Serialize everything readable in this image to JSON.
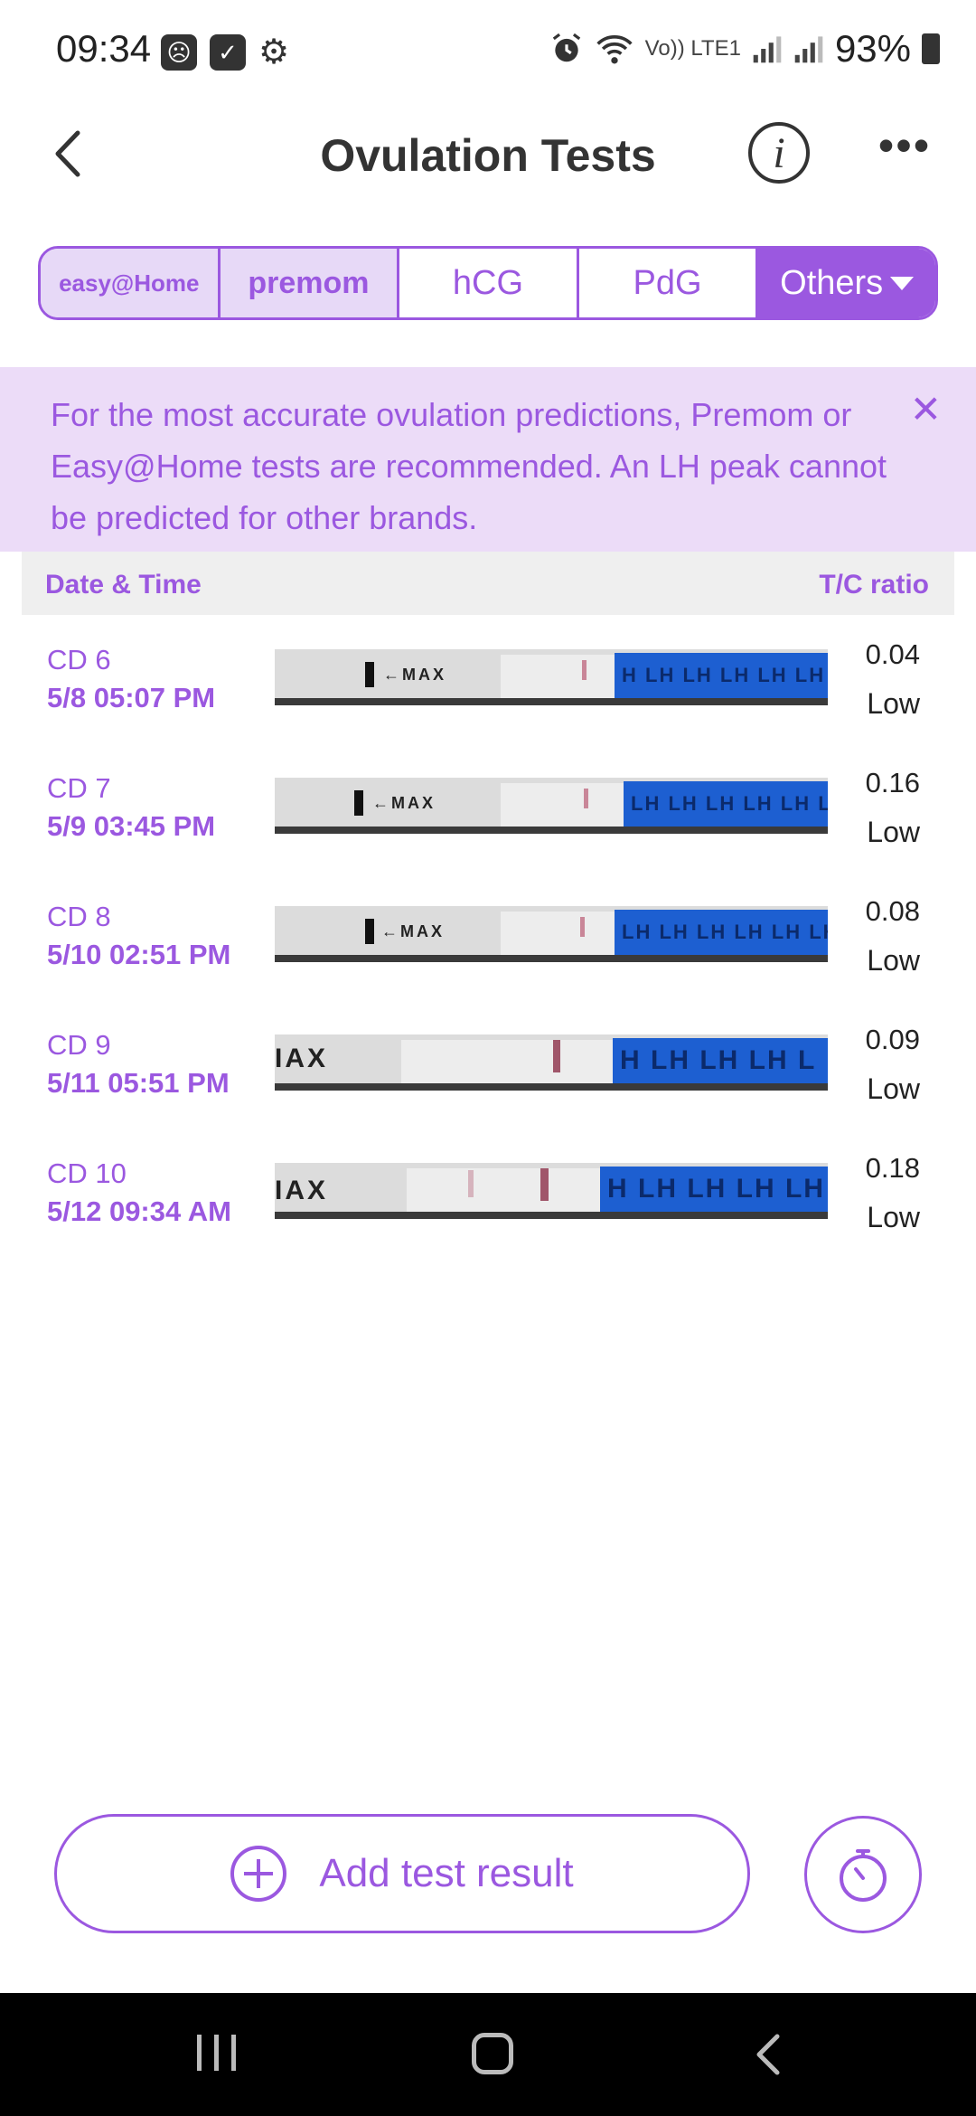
{
  "status_bar": {
    "time": "09:34",
    "battery": "93%",
    "network_label": "Vo)) LTE1",
    "icons": [
      "notification-icon",
      "checkbox-icon",
      "gear-icon",
      "alarm-icon",
      "wifi-icon",
      "signal-icon",
      "signal-icon",
      "battery-icon"
    ]
  },
  "header": {
    "title": "Ovulation Tests",
    "info_label": "i",
    "more_label": "•••"
  },
  "tabs": [
    {
      "label": "easy@Home",
      "active": false
    },
    {
      "label": "premom",
      "active": false
    },
    {
      "label": "hCG",
      "active": false
    },
    {
      "label": "PdG",
      "active": false
    },
    {
      "label": "Others",
      "active": true
    }
  ],
  "banner": {
    "text": "For the most accurate ovulation predictions, Premom or Easy@Home tests are recommended. An LH peak cannot be predicted for other brands.",
    "close_label": "✕"
  },
  "table": {
    "col_left": "Date & Time",
    "col_right": "T/C ratio",
    "rows": [
      {
        "cd": "CD 6",
        "datetime": "5/8  05:07 PM",
        "ratio": "0.04",
        "level": "Low",
        "strip_text": "←MAX",
        "blue_text": "H LH LH LH LH LH LH LH"
      },
      {
        "cd": "CD 7",
        "datetime": "5/9  03:45 PM",
        "ratio": "0.16",
        "level": "Low",
        "strip_text": "←MAX",
        "blue_text": "LH LH LH LH LH LH LH"
      },
      {
        "cd": "CD 8",
        "datetime": "5/10  02:51 PM",
        "ratio": "0.08",
        "level": "Low",
        "strip_text": "←MAX",
        "blue_text": "LH LH LH LH LH LH LH"
      },
      {
        "cd": "CD 9",
        "datetime": "5/11  05:51 PM",
        "ratio": "0.09",
        "level": "Low",
        "strip_text": "IAX",
        "blue_text": "H LH LH LH L"
      },
      {
        "cd": "CD 10",
        "datetime": "5/12  09:34 AM",
        "ratio": "0.18",
        "level": "Low",
        "strip_text": "IAX",
        "blue_text": "H LH LH LH LH"
      }
    ]
  },
  "actions": {
    "add_label": "Add test result"
  },
  "colors": {
    "accent": "#9b58e0",
    "banner_bg": "#ecdcf8",
    "strip_blue": "#1d5fd1"
  }
}
